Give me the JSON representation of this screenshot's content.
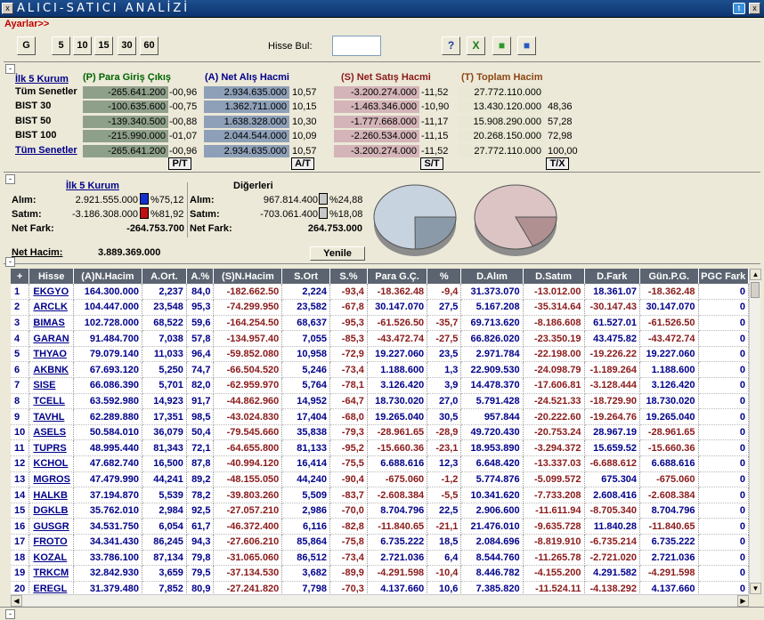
{
  "window": {
    "title": "ALICI-SATICI ANALİZİ",
    "close_glyph": "x",
    "twitter_glyph": "t"
  },
  "menu": {
    "ayarlar": "Ayarlar>>"
  },
  "toolbar": {
    "buttons": [
      "G",
      "5",
      "10",
      "15",
      "30",
      "60"
    ],
    "search_label": "Hisse Bul:",
    "search_value": "",
    "icons": [
      "help-icon",
      "excel-icon",
      "green-cubes-icon",
      "blue-cubes-icon"
    ]
  },
  "summary": {
    "kurum_link": "İlk 5 Kurum",
    "headers": {
      "p": "(P) Para Giriş Çıkış",
      "a": "(A) Net Alış Hacmi",
      "s": "(S) Net Satış Hacmi",
      "t": "(T) Toplam Hacim"
    },
    "rows": [
      {
        "label": "Tüm Senetler",
        "p": "-265.641.200",
        "pp": "-00,96",
        "a": "2.934.635.000",
        "ap": "10,57",
        "s": "-3.200.274.000",
        "sp": "-11,52",
        "t": "27.772.110.000",
        "tp": ""
      },
      {
        "label": "BIST 30",
        "p": "-100.635.600",
        "pp": "-00,75",
        "a": "1.362.711.000",
        "ap": "10,15",
        "s": "-1.463.346.000",
        "sp": "-10,90",
        "t": "13.430.120.000",
        "tp": "48,36"
      },
      {
        "label": "BIST 50",
        "p": "-139.340.500",
        "pp": "-00,88",
        "a": "1.638.328.000",
        "ap": "10,30",
        "s": "-1.777.668.000",
        "sp": "-11,17",
        "t": "15.908.290.000",
        "tp": "57,28"
      },
      {
        "label": "BIST 100",
        "p": "-215.990.000",
        "pp": "-01,07",
        "a": "2.044.544.000",
        "ap": "10,09",
        "s": "-2.260.534.000",
        "sp": "-11,15",
        "t": "20.268.150.000",
        "tp": "72,98"
      },
      {
        "label": "Tüm Senetler",
        "p": "-265.641.200",
        "pp": "-00,96",
        "a": "2.934.635.000",
        "ap": "10,57",
        "s": "-3.200.274.000",
        "sp": "-11,52",
        "t": "27.772.110.000",
        "tp": "100,00"
      }
    ],
    "buttons": {
      "p": "P/T",
      "a": "A/T",
      "s": "S/T",
      "t": "T/X"
    }
  },
  "kurum": {
    "title": "İlk 5 Kurum",
    "alim_label": "Alım:",
    "alim_value": "2.921.555.000",
    "alim_pct": "%75,12",
    "satim_label": "Satım:",
    "satim_value": "-3.186.308.000",
    "satim_pct": "%81,92",
    "netfark_label": "Net Fark:",
    "netfark_value": "-264.753.700",
    "nethacim_label": "Net Hacim:",
    "nethacim_value": "3.889.369.000",
    "colors": {
      "alim": "#1030d0",
      "satim": "#c01010"
    }
  },
  "digerleri": {
    "title": "Diğerleri",
    "alim_label": "Alım:",
    "alim_value": "967.814.400",
    "alim_pct": "%24,88",
    "satim_label": "Satım:",
    "satim_value": "-703.061.400",
    "satim_pct": "%18,08",
    "netfark_label": "Net Fark:",
    "netfark_value": "264.753.000"
  },
  "yenile": "Yenile",
  "pies": [
    {
      "name": "alim-pie",
      "share": 0.7512,
      "main": "#c7d3df",
      "slice": "#8a9aa8"
    },
    {
      "name": "satim-pie",
      "share": 0.8192,
      "main": "#dcc4c4",
      "slice": "#b09090"
    }
  ],
  "table": {
    "columns": [
      "+",
      "Hisse",
      "(A)N.Hacim",
      "A.Ort.",
      "A.%",
      "(S)N.Hacim",
      "S.Ort",
      "S.%",
      "Para G.Ç.",
      "%",
      "D.Alım",
      "D.Satım",
      "D.Fark",
      "Gün.P.G.",
      "PGC Fark"
    ],
    "rows": [
      [
        "1",
        "EKGYO",
        "164.300.000",
        "2,237",
        "84,0",
        "-182.662.50",
        "2,224",
        "-93,4",
        "-18.362.48",
        "-9,4",
        "31.373.070",
        "-13.012.00",
        "18.361.07",
        "-18.362.48",
        "0"
      ],
      [
        "2",
        "ARCLK",
        "104.447.000",
        "23,548",
        "95,3",
        "-74.299.950",
        "23,582",
        "-67,8",
        "30.147.070",
        "27,5",
        "5.167.208",
        "-35.314.64",
        "-30.147.43",
        "30.147.070",
        "0"
      ],
      [
        "3",
        "BIMAS",
        "102.728.000",
        "68,522",
        "59,6",
        "-164.254.50",
        "68,637",
        "-95,3",
        "-61.526.50",
        "-35,7",
        "69.713.620",
        "-8.186.608",
        "61.527.01",
        "-61.526.50",
        "0"
      ],
      [
        "4",
        "GARAN",
        "91.484.700",
        "7,038",
        "57,8",
        "-134.957.40",
        "7,055",
        "-85,3",
        "-43.472.74",
        "-27,5",
        "66.826.020",
        "-23.350.19",
        "43.475.82",
        "-43.472.74",
        "0"
      ],
      [
        "5",
        "THYAO",
        "79.079.140",
        "11,033",
        "96,4",
        "-59.852.080",
        "10,958",
        "-72,9",
        "19.227.060",
        "23,5",
        "2.971.784",
        "-22.198.00",
        "-19.226.22",
        "19.227.060",
        "0"
      ],
      [
        "6",
        "AKBNK",
        "67.693.120",
        "5,250",
        "74,7",
        "-66.504.520",
        "5,246",
        "-73,4",
        "1.188.600",
        "1,3",
        "22.909.530",
        "-24.098.79",
        "-1.189.264",
        "1.188.600",
        "0"
      ],
      [
        "7",
        "SISE",
        "66.086.390",
        "5,701",
        "82,0",
        "-62.959.970",
        "5,764",
        "-78,1",
        "3.126.420",
        "3,9",
        "14.478.370",
        "-17.606.81",
        "-3.128.444",
        "3.126.420",
        "0"
      ],
      [
        "8",
        "TCELL",
        "63.592.980",
        "14,923",
        "91,7",
        "-44.862.960",
        "14,952",
        "-64,7",
        "18.730.020",
        "27,0",
        "5.791.428",
        "-24.521.33",
        "-18.729.90",
        "18.730.020",
        "0"
      ],
      [
        "9",
        "TAVHL",
        "62.289.880",
        "17,351",
        "98,5",
        "-43.024.830",
        "17,404",
        "-68,0",
        "19.265.040",
        "30,5",
        "957.844",
        "-20.222.60",
        "-19.264.76",
        "19.265.040",
        "0"
      ],
      [
        "10",
        "ASELS",
        "50.584.010",
        "36,079",
        "50,4",
        "-79.545.660",
        "35,838",
        "-79,3",
        "-28.961.65",
        "-28,9",
        "49.720.430",
        "-20.753.24",
        "28.967.19",
        "-28.961.65",
        "0"
      ],
      [
        "11",
        "TUPRS",
        "48.995.440",
        "81,343",
        "72,1",
        "-64.655.800",
        "81,133",
        "-95,2",
        "-15.660.36",
        "-23,1",
        "18.953.890",
        "-3.294.372",
        "15.659.52",
        "-15.660.36",
        "0"
      ],
      [
        "12",
        "KCHOL",
        "47.682.740",
        "16,500",
        "87,8",
        "-40.994.120",
        "16,414",
        "-75,5",
        "6.688.616",
        "12,3",
        "6.648.420",
        "-13.337.03",
        "-6.688.612",
        "6.688.616",
        "0"
      ],
      [
        "13",
        "MGROS",
        "47.479.990",
        "44,241",
        "89,2",
        "-48.155.050",
        "44,240",
        "-90,4",
        "-675.060",
        "-1,2",
        "5.774.876",
        "-5.099.572",
        "675.304",
        "-675.060",
        "0"
      ],
      [
        "14",
        "HALKB",
        "37.194.870",
        "5,539",
        "78,2",
        "-39.803.260",
        "5,509",
        "-83,7",
        "-2.608.384",
        "-5,5",
        "10.341.620",
        "-7.733.208",
        "2.608.416",
        "-2.608.384",
        "0"
      ],
      [
        "15",
        "DGKLB",
        "35.762.010",
        "2,984",
        "92,5",
        "-27.057.210",
        "2,986",
        "-70,0",
        "8.704.796",
        "22,5",
        "2.906.600",
        "-11.611.94",
        "-8.705.340",
        "8.704.796",
        "0"
      ],
      [
        "16",
        "GUSGR",
        "34.531.750",
        "6,054",
        "61,7",
        "-46.372.400",
        "6,116",
        "-82,8",
        "-11.840.65",
        "-21,1",
        "21.476.010",
        "-9.635.728",
        "11.840.28",
        "-11.840.65",
        "0"
      ],
      [
        "17",
        "FROTO",
        "34.341.430",
        "86,245",
        "94,3",
        "-27.606.210",
        "85,864",
        "-75,8",
        "6.735.222",
        "18,5",
        "2.084.696",
        "-8.819.910",
        "-6.735.214",
        "6.735.222",
        "0"
      ],
      [
        "18",
        "KOZAL",
        "33.786.100",
        "87,134",
        "79,8",
        "-31.065.060",
        "86,512",
        "-73,4",
        "2.721.036",
        "6,4",
        "8.544.760",
        "-11.265.78",
        "-2.721.020",
        "2.721.036",
        "0"
      ],
      [
        "19",
        "TRKCM",
        "32.842.930",
        "3,659",
        "79,5",
        "-37.134.530",
        "3,682",
        "-89,9",
        "-4.291.598",
        "-10,4",
        "8.446.782",
        "-4.155.200",
        "4.291.582",
        "-4.291.598",
        "0"
      ],
      [
        "20",
        "EREGL",
        "31.379.480",
        "7,852",
        "80,9",
        "-27.241.820",
        "7,798",
        "-70,3",
        "4.137.660",
        "10,6",
        "7.385.820",
        "-11.524.11",
        "-4.138.292",
        "4.137.660",
        "0"
      ],
      [
        "21",
        "ISGYO",
        "30.995.820",
        "2,064",
        "70,6",
        "-35.715.650",
        "2,053",
        "-81,3",
        "-4.719.826",
        "-10,7",
        "12.912.570",
        "-8.192.644",
        "4.719.926",
        "-4.719.826",
        "0"
      ],
      [
        "22",
        "KRDMD",
        "26.700.390",
        "2,964",
        "63,5",
        "-34.851.790",
        "3,039",
        "-82,9",
        "8.151.400",
        "19,4",
        "15.329.690",
        "-7.178.796",
        "8.150.896",
        "8.151.400",
        "0"
      ]
    ]
  }
}
